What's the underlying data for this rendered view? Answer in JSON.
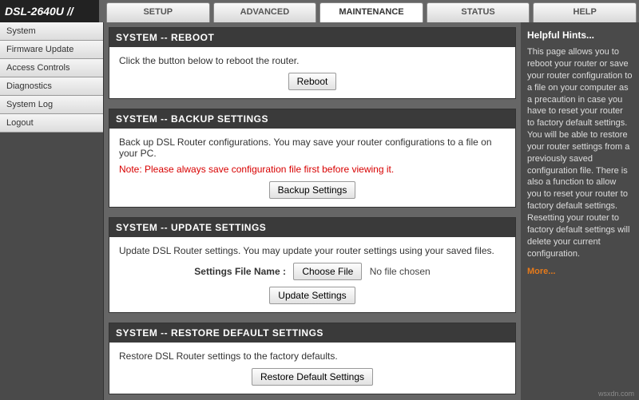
{
  "brand": "DSL-2640U",
  "tabs": [
    "SETUP",
    "ADVANCED",
    "MAINTENANCE",
    "STATUS",
    "HELP"
  ],
  "activeTab": "MAINTENANCE",
  "sidebar": {
    "items": [
      "System",
      "Firmware Update",
      "Access Controls",
      "Diagnostics",
      "System Log",
      "Logout"
    ]
  },
  "panels": {
    "reboot": {
      "title": "SYSTEM -- REBOOT",
      "text": "Click the button below to reboot the router.",
      "button": "Reboot"
    },
    "backup": {
      "title": "SYSTEM -- BACKUP SETTINGS",
      "text": "Back up DSL Router configurations. You may save your router configurations to a file on your PC.",
      "note": "Note: Please always save configuration file first before viewing it.",
      "button": "Backup Settings"
    },
    "update": {
      "title": "SYSTEM -- UPDATE SETTINGS",
      "text": "Update DSL Router settings. You may update your router settings using your saved files.",
      "fileLabel": "Settings File Name :",
      "chooseFile": "Choose File",
      "noFile": "No file chosen",
      "button": "Update Settings"
    },
    "restore": {
      "title": "SYSTEM -- RESTORE DEFAULT SETTINGS",
      "text": "Restore DSL Router settings to the factory defaults.",
      "button": "Restore Default Settings"
    }
  },
  "hints": {
    "head": "Helpful Hints...",
    "body": "This page allows you to reboot your router or save your router configuration to a file on your computer as a precaution in case you have to reset your router to factory default settings. You will be able to restore your router settings from a previously saved configuration file. There is also a function to allow you to reset your router to factory default settings. Resetting your router to factory default settings will delete your current configuration.",
    "more": "More..."
  },
  "watermark": "wsxdn.com"
}
